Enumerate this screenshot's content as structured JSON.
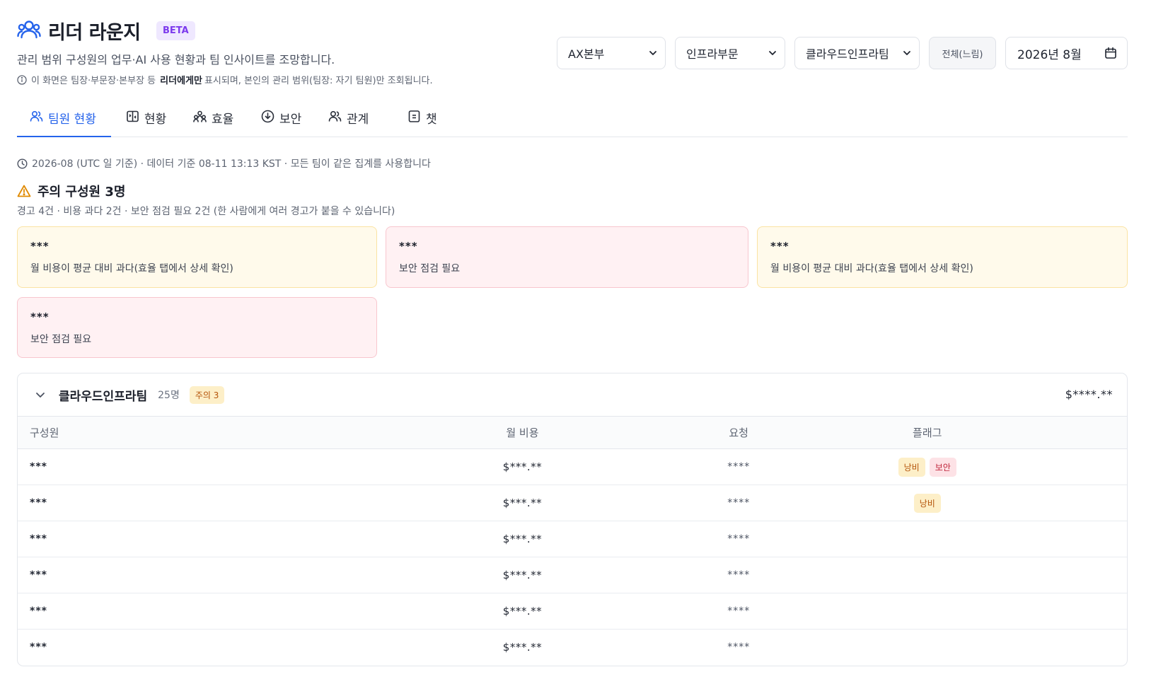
{
  "header": {
    "title": "리더 라운지",
    "badge": "BETA",
    "subtitle": "관리 범위 구성원의 업무·AI 사용 현황과 팀 인사이트를 조망합니다.",
    "notice_pre": "이 화면은 팀장·부문장·본부장 등",
    "notice_bold": "리더에게만",
    "notice_post": "표시되며, 본인의 관리 범위(팀장: 자기 팀원)만 조회됩니다."
  },
  "filters": {
    "division": "AX본부",
    "department": "인프라부문",
    "team": "클라우드인프라팀",
    "all_button": "전체(느림)",
    "month": "2026년 8월"
  },
  "tabs": [
    {
      "label": "팀원 현황",
      "icon": "users-icon",
      "active": true
    },
    {
      "label": "현황",
      "icon": "layout-icon",
      "active": false
    },
    {
      "label": "효율",
      "icon": "group-icon",
      "active": false
    },
    {
      "label": "보안",
      "icon": "shield-download-icon",
      "active": false
    },
    {
      "label": "관계",
      "icon": "people-icon",
      "active": false
    },
    {
      "label": "챗",
      "icon": "chat-icon",
      "active": false
    }
  ],
  "meta": {
    "text": "2026-08 (UTC 일 기준) · 데이터 기준 08-11 13:13 KST · 모든 팀이 같은 집계를 사용합니다"
  },
  "warnings": {
    "title": "주의 구성원 3명",
    "summary": "경고 4건 · 비용 과다 2건 · 보안 점검 필요 2건 (한 사람에게 여러 경고가 붙을 수 있습니다)",
    "cards": [
      {
        "name": "***",
        "desc": "월 비용이 평균 대비 과다(효율 탭에서 상세 확인)",
        "level": "yellow"
      },
      {
        "name": "***",
        "desc": "보안 점검 필요",
        "level": "red"
      },
      {
        "name": "***",
        "desc": "월 비용이 평균 대비 과다(효율 탭에서 상세 확인)",
        "level": "yellow"
      },
      {
        "name": "***",
        "desc": "보안 점검 필요",
        "level": "red"
      }
    ]
  },
  "team": {
    "name": "클라우드인프라팀",
    "count": "25명",
    "badge": "주의 3",
    "total": "$****.**",
    "columns": [
      "구성원",
      "월 비용",
      "요청",
      "플래그"
    ],
    "rows": [
      {
        "member": "***",
        "cost": "$***.**",
        "requests": "****",
        "flags": [
          "낭비",
          "보안"
        ]
      },
      {
        "member": "***",
        "cost": "$***.**",
        "requests": "****",
        "flags": [
          "낭비"
        ]
      },
      {
        "member": "***",
        "cost": "$***.**",
        "requests": "****",
        "flags": []
      },
      {
        "member": "***",
        "cost": "$***.**",
        "requests": "****",
        "flags": []
      },
      {
        "member": "***",
        "cost": "$***.**",
        "requests": "****",
        "flags": []
      },
      {
        "member": "***",
        "cost": "$***.**",
        "requests": "****",
        "flags": []
      }
    ]
  },
  "colors": {
    "accent": "#2563eb",
    "warning_bg": "#fffaeb",
    "danger_bg": "#fff1f3",
    "badge_purple": "#7c3aed"
  }
}
